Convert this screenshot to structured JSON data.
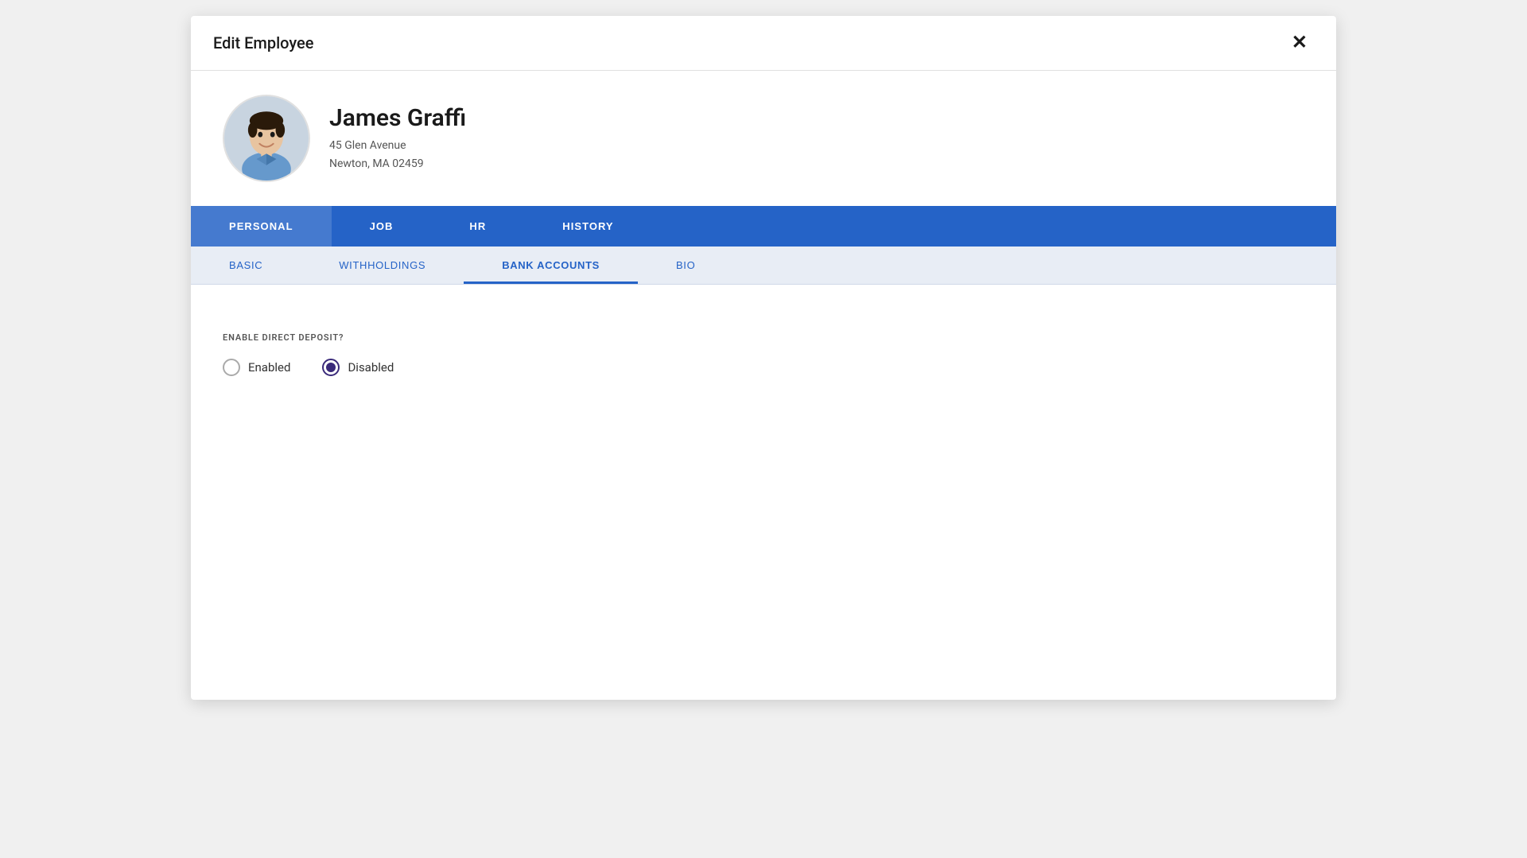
{
  "modal": {
    "title": "Edit Employee",
    "close_label": "✕"
  },
  "employee": {
    "name": "James Graffi",
    "address_line1": "45 Glen Avenue",
    "address_line2": "Newton, MA 02459"
  },
  "primary_tabs": [
    {
      "id": "personal",
      "label": "PERSONAL",
      "active": true
    },
    {
      "id": "job",
      "label": "JOB",
      "active": false
    },
    {
      "id": "hr",
      "label": "HR",
      "active": false
    },
    {
      "id": "history",
      "label": "HISTORY",
      "active": false
    }
  ],
  "secondary_tabs": [
    {
      "id": "basic",
      "label": "BASIC",
      "active": false
    },
    {
      "id": "withholdings",
      "label": "WITHHOLDINGS",
      "active": false
    },
    {
      "id": "bank-accounts",
      "label": "BANK ACCOUNTS",
      "active": true
    },
    {
      "id": "bio",
      "label": "BIO",
      "active": false
    }
  ],
  "content": {
    "direct_deposit_label": "ENABLE DIRECT DEPOSIT?",
    "radio_enabled_label": "Enabled",
    "radio_disabled_label": "Disabled",
    "selected_option": "disabled"
  },
  "colors": {
    "primary_blue": "#2563c7",
    "dark_purple": "#3a2a7a",
    "secondary_bg": "#e8edf5"
  }
}
